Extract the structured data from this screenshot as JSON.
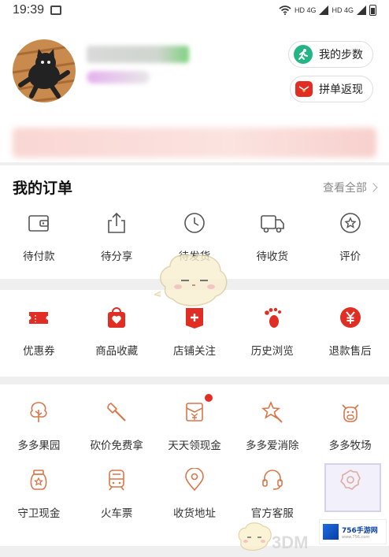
{
  "status_bar": {
    "time": "19:39",
    "network": "HD 4G",
    "network2": "HD 4G"
  },
  "profile": {
    "steps_label": "我的步数",
    "rebate_label": "拼单返现"
  },
  "orders": {
    "title": "我的订单",
    "view_all": "查看全部",
    "items": [
      {
        "label": "待付款",
        "icon": "wallet-icon"
      },
      {
        "label": "待分享",
        "icon": "share-icon"
      },
      {
        "label": "待发货",
        "icon": "clock-icon"
      },
      {
        "label": "待收货",
        "icon": "truck-icon"
      },
      {
        "label": "评价",
        "icon": "star-bubble-icon"
      }
    ]
  },
  "tools": {
    "items": [
      {
        "label": "优惠券",
        "icon": "coupon-icon"
      },
      {
        "label": "商品收藏",
        "icon": "heart-bag-icon"
      },
      {
        "label": "店铺关注",
        "icon": "shop-plus-icon"
      },
      {
        "label": "历史浏览",
        "icon": "footprint-icon"
      },
      {
        "label": "退款售后",
        "icon": "yen-icon"
      }
    ]
  },
  "games": {
    "row1": [
      {
        "label": "多多果园",
        "icon": "tree-icon"
      },
      {
        "label": "砍价免费拿",
        "icon": "axe-icon"
      },
      {
        "label": "天天领现金",
        "icon": "cash-envelope-icon"
      },
      {
        "label": "多多爱消除",
        "icon": "star-wand-icon"
      },
      {
        "label": "多多牧场",
        "icon": "cow-icon"
      }
    ],
    "row2": [
      {
        "label": "守卫现金",
        "icon": "money-jar-icon"
      },
      {
        "label": "火车票",
        "icon": "train-icon"
      },
      {
        "label": "收货地址",
        "icon": "location-icon"
      },
      {
        "label": "官方客服",
        "icon": "headset-icon"
      },
      {
        "label": "",
        "icon": "settings-icon"
      }
    ]
  },
  "watermark": {
    "text": "3DM",
    "badge_title": "756手游网",
    "badge_sub": "www.756.com"
  },
  "colors": {
    "accent_red": "#e02e24",
    "accent_orange": "#d9774a",
    "accent_green": "#23b583",
    "notification_dot": "#e02e24"
  }
}
